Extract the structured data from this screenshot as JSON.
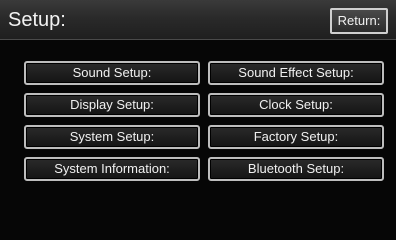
{
  "header": {
    "title": "Setup:",
    "return_label": "Return:"
  },
  "menu": {
    "items": [
      {
        "label": "Sound Setup:"
      },
      {
        "label": "Sound Effect Setup:"
      },
      {
        "label": "Display Setup:"
      },
      {
        "label": "Clock Setup:"
      },
      {
        "label": "System Setup:"
      },
      {
        "label": "Factory Setup:"
      },
      {
        "label": "System Information:"
      },
      {
        "label": "Bluetooth Setup:"
      }
    ]
  }
}
